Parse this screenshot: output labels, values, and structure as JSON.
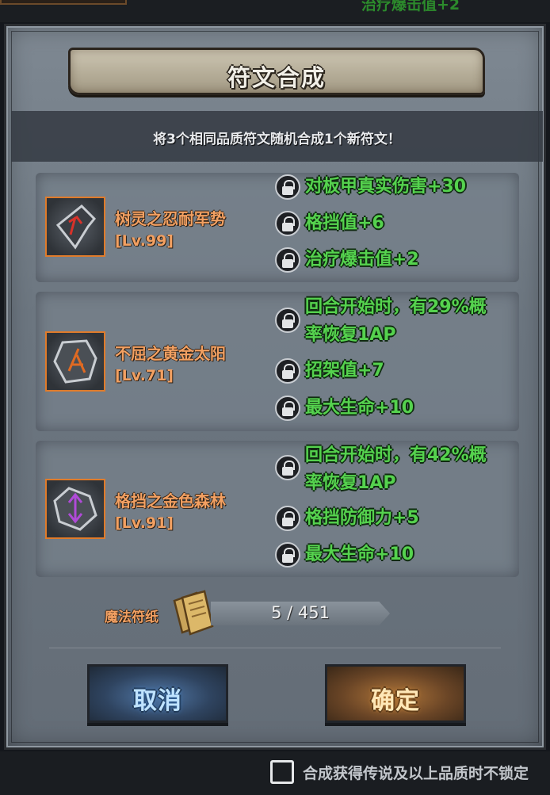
{
  "top_bar": {
    "partial_text": "治疗爆击值+2"
  },
  "dialog": {
    "title": "符文合成",
    "subtitle": "将3个相同品质符文随机合成1个新符文！"
  },
  "runes": [
    {
      "name": "树灵之忍耐军势",
      "level": "[Lv.99]",
      "icon": "arrowhead-rune-icon",
      "stats": [
        "对板甲真实伤害+30",
        "格挡值+6",
        "治疗爆击值+2"
      ]
    },
    {
      "name": "不屈之黄金太阳",
      "level": "[Lv.71]",
      "icon": "stone-rune-icon",
      "stats": [
        "回合开始时，有29%概率恢复1AP",
        "招架值+7",
        "最大生命+10"
      ]
    },
    {
      "name": "格挡之金色森林",
      "level": "[Lv.91]",
      "icon": "crystal-rune-icon",
      "stats": [
        "回合开始时，有42%概率恢复1AP",
        "格挡防御力+5",
        "最大生命+10"
      ]
    }
  ],
  "stat_lines": {
    "r2_s1_line1": "回合开始时，有29%概",
    "r2_s1_line2": "率恢复1AP",
    "r3_s1_line1": "回合开始时，有42%概",
    "r3_s1_line2": "率恢复1AP"
  },
  "magic_paper": {
    "label": "魔法符纸",
    "count": "5 / 451",
    "icon": "paper-scroll-icon"
  },
  "buttons": {
    "cancel": "取消",
    "confirm": "确定"
  },
  "footer": {
    "checkbox_label": "合成获得传说及以上品质时不锁定"
  },
  "colors": {
    "stat_green": "#55d24e",
    "rune_orange": "#f2a062",
    "icon_border": "#e07b2a"
  }
}
